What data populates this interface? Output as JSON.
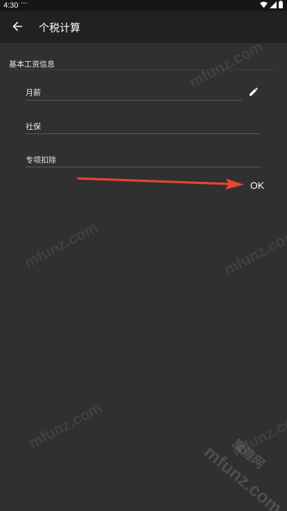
{
  "status": {
    "time": "4:30",
    "dots": "···"
  },
  "appbar": {
    "title": "个税计算"
  },
  "section": {
    "title": "基本工资信息"
  },
  "fields": {
    "salary": "月薪",
    "social": "社保",
    "deduction": "专项扣除"
  },
  "ok_label": "OK",
  "watermark": {
    "text": "mfunz.com",
    "brand": "魔趣网"
  },
  "colors": {
    "accent_arrow": "#e8452c",
    "background": "#303030",
    "appbar": "#212121"
  }
}
